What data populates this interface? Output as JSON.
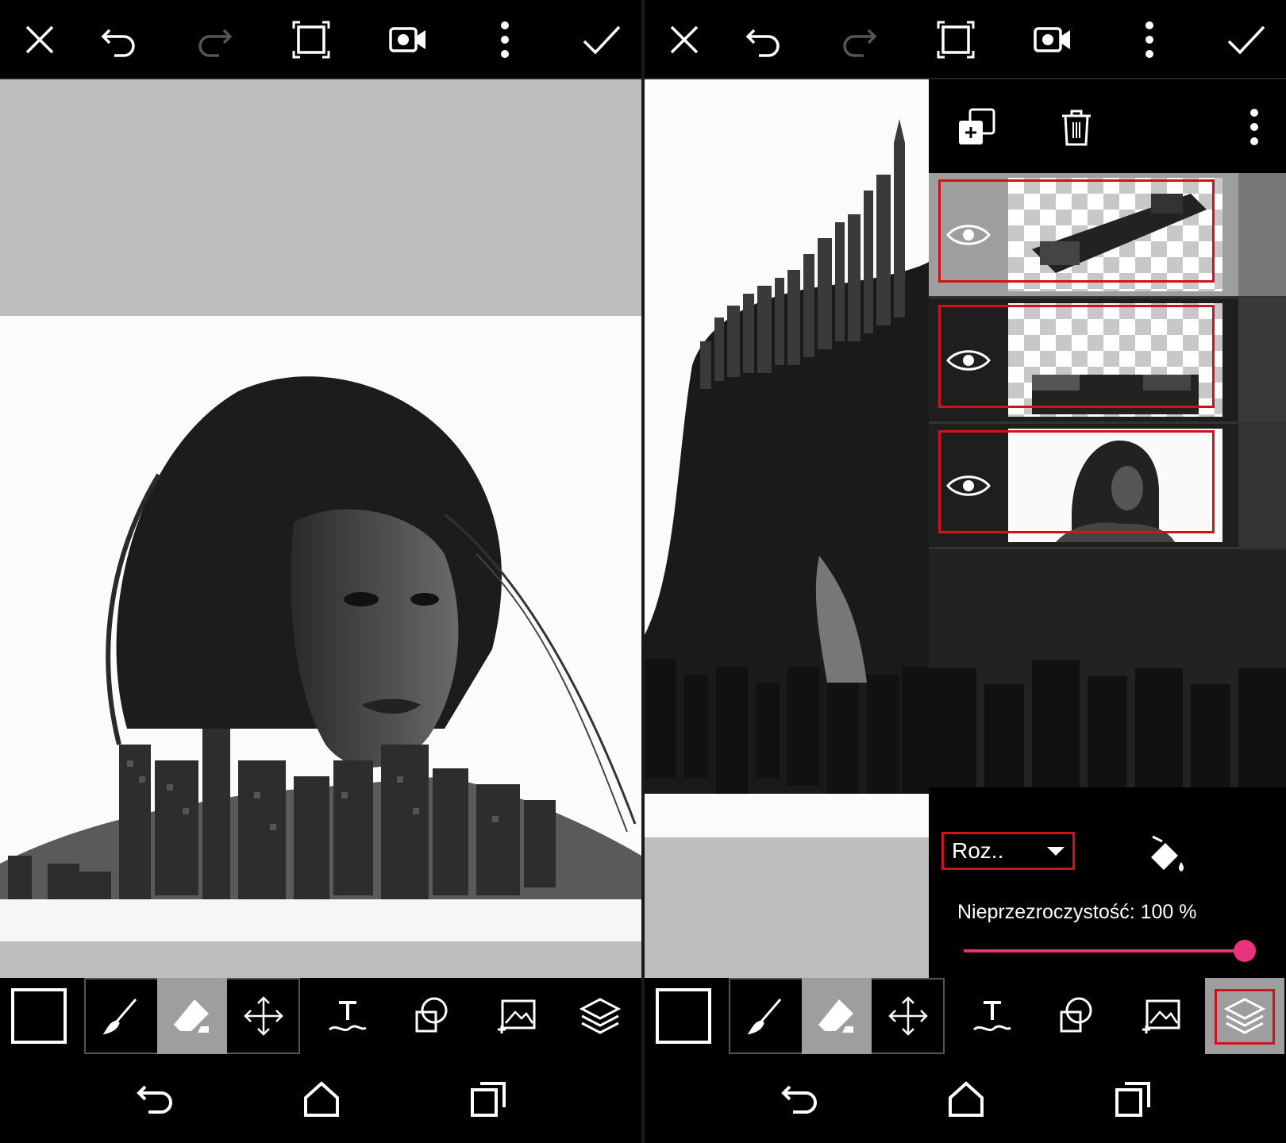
{
  "left": {
    "toolbar": {
      "close": "close-icon",
      "undo": "undo-icon",
      "redo": "redo-icon",
      "crop": "fit-screen-icon",
      "record": "video-record-icon",
      "more": "more-vertical-icon",
      "apply": "check-icon"
    },
    "tools": [
      "color-swatch",
      "brush-icon",
      "eraser-icon",
      "move-icon",
      "text-icon",
      "shape-icon",
      "add-photo-icon",
      "layers-icon"
    ]
  },
  "right": {
    "toolbar": {
      "close": "close-icon",
      "undo": "undo-icon",
      "redo": "redo-icon",
      "crop": "fit-screen-icon",
      "record": "video-record-icon",
      "more": "more-vertical-icon",
      "apply": "check-icon"
    },
    "layers_panel": {
      "actions": [
        "duplicate-layer-icon",
        "delete-layer-icon",
        "more-vertical-icon"
      ],
      "layers": [
        {
          "name": "city-skyline-layer",
          "visible": true
        },
        {
          "name": "city-bottom-layer",
          "visible": true
        },
        {
          "name": "portrait-layer",
          "visible": true
        }
      ],
      "blend_mode": "Roz..",
      "opacity_label": "Nieprzezroczystość: 100 %",
      "opacity": 1.0
    }
  },
  "colors": {
    "highlight": "#d0121b",
    "slider": "#e8337a",
    "canvas_bg": "#bdbdbd",
    "toolbar_bg": "#000000",
    "selected_tool_bg": "#9e9e9e"
  }
}
